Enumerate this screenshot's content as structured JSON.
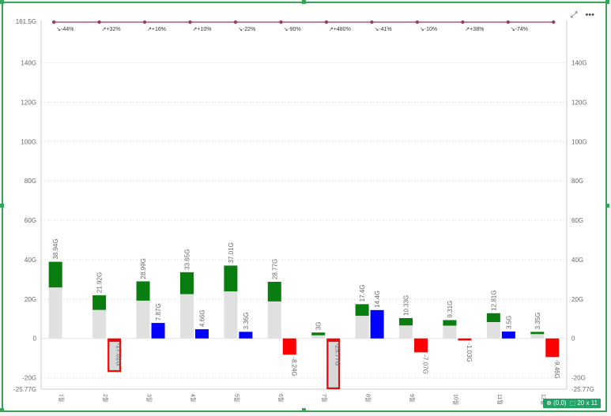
{
  "toolbar": {
    "expand_icon": "expand-icon",
    "more_label": "•••"
  },
  "status": {
    "origin": "⊕ (0,0)",
    "size": "⬚ 20 x 11"
  },
  "colors": {
    "base": "#e0e0e0",
    "increase": "#0a7d10",
    "positive_change": "#0000ff",
    "negative_change": "#ff0000",
    "indicator_line": "#9b3b6b",
    "grid": "#e6e6e6",
    "axis_text": "#666666"
  },
  "chart_data": {
    "type": "bar",
    "categories": [
      "1월",
      "2월",
      "3월",
      "4월",
      "5월",
      "6월",
      "7월",
      "8월",
      "9월",
      "10월",
      "11월",
      "12월"
    ],
    "ylim": [
      -25.77,
      161.5
    ],
    "y_ticks": [
      -20,
      0,
      20,
      40,
      60,
      80,
      100,
      120,
      140
    ],
    "y_tick_labels": [
      "-20G",
      "0",
      "20G",
      "40G",
      "60G",
      "80G",
      "100G",
      "120G",
      "140G"
    ],
    "y_min_label": "-25.77G",
    "y_max_label": "161.5G",
    "grid": true,
    "stacked": {
      "base": [
        25.9,
        14.5,
        19.2,
        22.5,
        23.9,
        18.8,
        1.6,
        11.5,
        6.6,
        6.5,
        8.3,
        2.2
      ],
      "total": [
        38.94,
        21.92,
        28.99,
        33.65,
        37.01,
        28.77,
        3.0,
        17.4,
        10.33,
        9.31,
        12.81,
        3.35
      ],
      "total_labels": [
        "38.94G",
        "21.92G",
        "28.99G",
        "33.65G",
        "37.01G",
        "28.77G",
        "3G",
        "17.4G",
        "10.33G",
        "9.31G",
        "12.81G",
        "3.35G"
      ]
    },
    "change": {
      "values": [
        null,
        -17.02,
        7.87,
        4.66,
        3.36,
        -8.24,
        -25.77,
        14.4,
        -7.07,
        -1.03,
        3.5,
        -9.46
      ],
      "labels": [
        "",
        "-17.02G",
        "7.87G",
        "4.66G",
        "3.36G",
        "-8.24G",
        "-25.77G",
        "14.4G",
        "-7.07G",
        "-1.03G",
        "3.5G",
        "-9.46G"
      ],
      "highlighted": [
        false,
        true,
        false,
        false,
        false,
        false,
        true,
        false,
        false,
        false,
        false,
        false
      ]
    },
    "indicator": {
      "labels": [
        "-44%",
        "+32%",
        "+16%",
        "+10%",
        "-22%",
        "-90%",
        "+480%",
        "-41%",
        "-10%",
        "+38%",
        "-74%"
      ],
      "arrows": [
        "↘",
        "↗",
        "↗",
        "↗",
        "↘",
        "↘",
        "↗",
        "↘",
        "↘",
        "↗",
        "↘"
      ]
    }
  }
}
